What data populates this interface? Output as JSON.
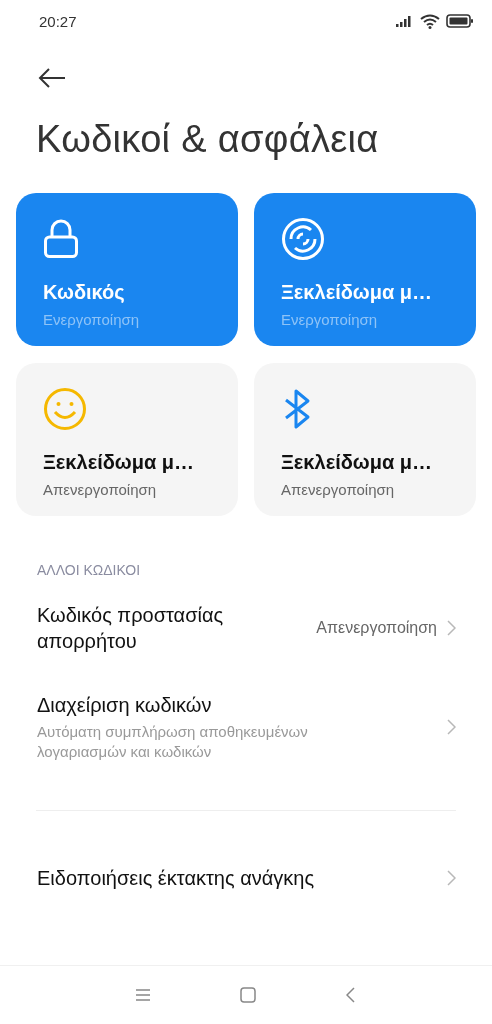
{
  "status_bar": {
    "time": "20:27"
  },
  "title": "Κωδικοί & ασφάλεια",
  "tiles": [
    {
      "kind": "lock",
      "title": "Κωδικός",
      "status": "Ενεργοποίηση",
      "on": true
    },
    {
      "kind": "fingerprint",
      "title": "Ξεκλείδωμα μ…",
      "status": "Ενεργοποίηση",
      "on": true
    },
    {
      "kind": "face",
      "title": "Ξεκλείδωμα μ…",
      "status": "Απενεργοποίηση",
      "on": false
    },
    {
      "kind": "bluetooth",
      "title": "Ξεκλείδωμα μ…",
      "status": "Απενεργοποίηση",
      "on": false
    }
  ],
  "groups": [
    {
      "heading": "ΑΛΛΟΙ ΚΩΔΙΚΟΙ",
      "items": [
        {
          "title": "Κωδικός προστασίας απορρήτου",
          "value": "Απενεργοποίηση"
        },
        {
          "title": "Διαχείριση κωδικών",
          "subtitle": "Αυτόματη συμπλήρωση αποθηκευμένων λογαριασμών και κωδικών"
        }
      ]
    },
    {
      "items": [
        {
          "title": "Ειδοποιήσεις έκτακτης ανάγκης"
        }
      ]
    }
  ]
}
